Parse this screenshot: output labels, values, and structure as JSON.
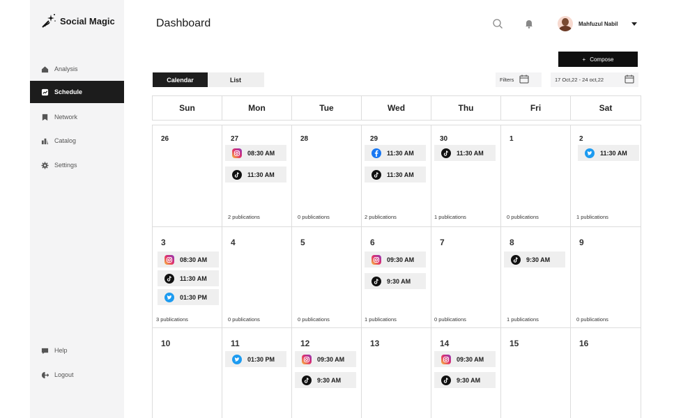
{
  "brand": {
    "name": "Social Magic"
  },
  "sidebar": {
    "items": [
      {
        "label": "Analysis",
        "icon": "home-icon"
      },
      {
        "label": "Schedule",
        "icon": "chart-icon",
        "active": true
      },
      {
        "label": "Network",
        "icon": "bookmark-icon"
      },
      {
        "label": "Catalog",
        "icon": "catalog-icon"
      },
      {
        "label": "Settings",
        "icon": "gear-icon"
      }
    ],
    "bottom": [
      {
        "label": "Help",
        "icon": "help-icon"
      },
      {
        "label": "Logout",
        "icon": "logout-icon"
      }
    ]
  },
  "header": {
    "title": "Dashboard",
    "user_name": "Mahfuzul Nabil",
    "compose_label": "Compose",
    "compose_plus": "+"
  },
  "view_toggle": {
    "calendar": "Calendar",
    "list": "List",
    "active": "Calendar"
  },
  "filters": {
    "label": "Filters",
    "date_range": "17 Oct,22 - 24 oct,22"
  },
  "calendar": {
    "weekdays": [
      "Sun",
      "Mon",
      "Tue",
      "Wed",
      "Thu",
      "Fri",
      "Sat"
    ],
    "weeks": [
      [
        {
          "day": "26",
          "posts": [],
          "pubs": ""
        },
        {
          "day": "27",
          "posts": [
            {
              "platform": "instagram",
              "time": "08:30 AM"
            },
            {
              "platform": "tiktok",
              "time": "11:30 AM"
            }
          ],
          "pubs": "2 publications"
        },
        {
          "day": "28",
          "posts": [],
          "pubs": "0 publications"
        },
        {
          "day": "29",
          "posts": [
            {
              "platform": "facebook",
              "time": "11:30 AM"
            },
            {
              "platform": "tiktok",
              "time": "11:30 AM"
            }
          ],
          "pubs": "2 publications"
        },
        {
          "day": "30",
          "posts": [
            {
              "platform": "tiktok",
              "time": "11:30 AM"
            }
          ],
          "pubs": "1 publications"
        },
        {
          "day": "1",
          "posts": [],
          "pubs": "0 publications"
        },
        {
          "day": "2",
          "posts": [
            {
              "platform": "twitter",
              "time": "11:30 AM"
            }
          ],
          "pubs": "1 publications"
        }
      ],
      [
        {
          "day": "3",
          "posts": [
            {
              "platform": "instagram",
              "time": "08:30 AM"
            },
            {
              "platform": "tiktok",
              "time": "11:30 AM"
            },
            {
              "platform": "twitter",
              "time": "01:30 PM"
            }
          ],
          "pubs": "3 publications"
        },
        {
          "day": "4",
          "posts": [],
          "pubs": "0 publications"
        },
        {
          "day": "5",
          "posts": [],
          "pubs": "0 publications"
        },
        {
          "day": "6",
          "posts": [
            {
              "platform": "instagram",
              "time": "09:30 AM"
            },
            {
              "platform": "tiktok",
              "time": "9:30 AM"
            }
          ],
          "pubs": "1 publications"
        },
        {
          "day": "7",
          "posts": [],
          "pubs": "0 publications"
        },
        {
          "day": "8",
          "posts": [
            {
              "platform": "tiktok",
              "time": "9:30 AM"
            }
          ],
          "pubs": "1 publications"
        },
        {
          "day": "9",
          "posts": [],
          "pubs": "0 publications"
        }
      ],
      [
        {
          "day": "10",
          "posts": [],
          "pubs": ""
        },
        {
          "day": "11",
          "posts": [
            {
              "platform": "twitter",
              "time": "01:30 PM"
            }
          ],
          "pubs": ""
        },
        {
          "day": "12",
          "posts": [
            {
              "platform": "instagram",
              "time": "09:30 AM"
            },
            {
              "platform": "tiktok",
              "time": "9:30 AM"
            }
          ],
          "pubs": ""
        },
        {
          "day": "13",
          "posts": [],
          "pubs": ""
        },
        {
          "day": "14",
          "posts": [
            {
              "platform": "instagram",
              "time": "09:30 AM"
            },
            {
              "platform": "tiktok",
              "time": "9:30 AM"
            }
          ],
          "pubs": ""
        },
        {
          "day": "15",
          "posts": [],
          "pubs": ""
        },
        {
          "day": "16",
          "posts": [],
          "pubs": ""
        }
      ]
    ]
  },
  "colors": {
    "active_nav": "#1c1c1c",
    "instagram": "#e1306c",
    "tiktok": "#111111",
    "twitter": "#1d9bf0",
    "facebook": "#1877f2"
  }
}
